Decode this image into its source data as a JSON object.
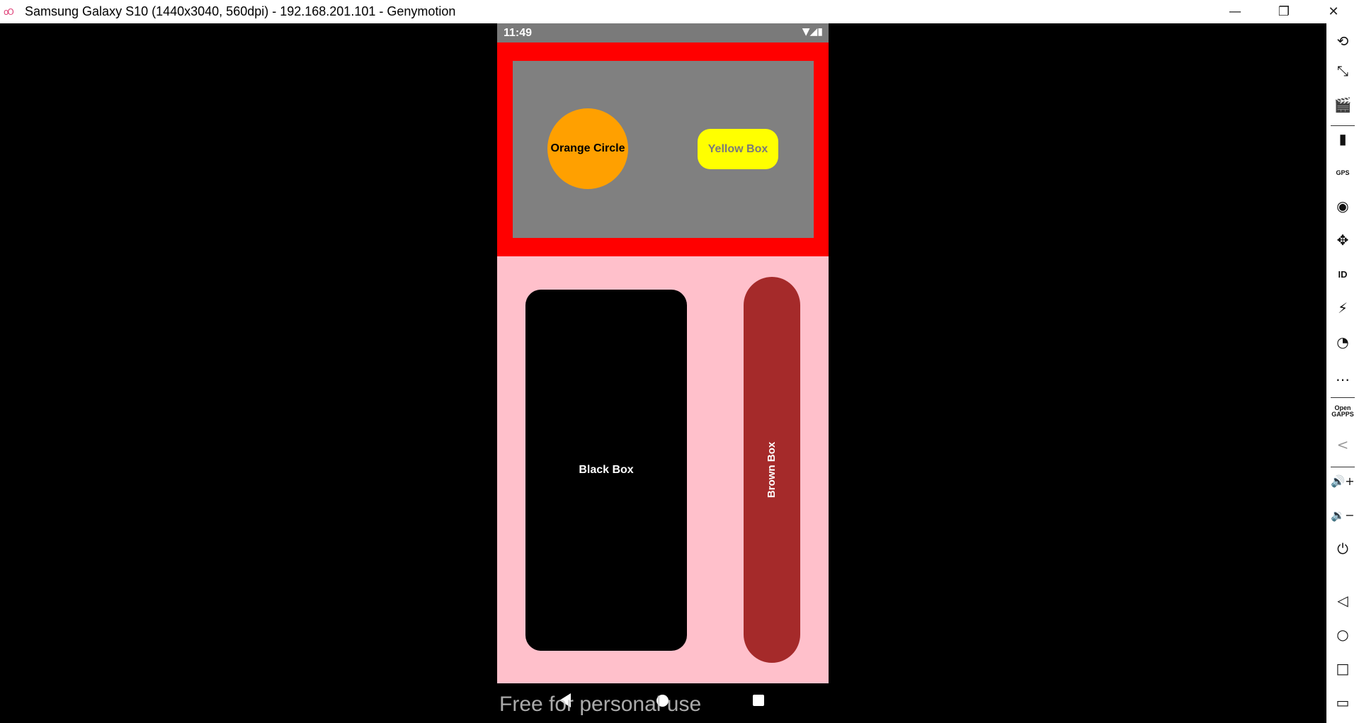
{
  "window": {
    "title": "Samsung Galaxy S10 (1440x3040, 560dpi) - 192.168.201.101 - Genymotion",
    "logo_glyph": "oO",
    "minimize_glyph": "—",
    "maximize_glyph": "❐",
    "close_glyph": "✕"
  },
  "status_bar": {
    "time": "11:49",
    "icons": [
      "wifi-icon",
      "signal-icon",
      "battery-icon"
    ],
    "icon_glyphs": "▼◢▮"
  },
  "app": {
    "orange_circle_label": "Orange Circle",
    "yellow_box_label": "Yellow Box",
    "black_box_label": "Black Box",
    "brown_box_label": "Brown Box",
    "colors": {
      "top_background": "#ff0000",
      "panel": "#808080",
      "orange": "#ffa000",
      "yellow": "#ffff00",
      "bottom_background": "#ffc0cb",
      "black": "#000000",
      "brown": "#a52a2a"
    }
  },
  "nav_bar": {
    "buttons": [
      "back-icon",
      "home-icon",
      "recents-icon"
    ]
  },
  "watermark": "Free for personal use",
  "toolbar": {
    "rotate": "⟲",
    "pixel_perfect": "⤡",
    "capture": "🎬",
    "battery": "▮",
    "gps": "GPS",
    "camera": "◉",
    "dpad": "✥",
    "id": "ID",
    "disk_io": "⚡",
    "cast": "◔",
    "sms": "…",
    "open_gapps": "Open GAPPS",
    "share": "<",
    "volume_up": "🔊+",
    "volume_down": "🔉−",
    "power": "⏻",
    "back": "◁",
    "home": "○",
    "recents": "□",
    "menu": "▭"
  }
}
